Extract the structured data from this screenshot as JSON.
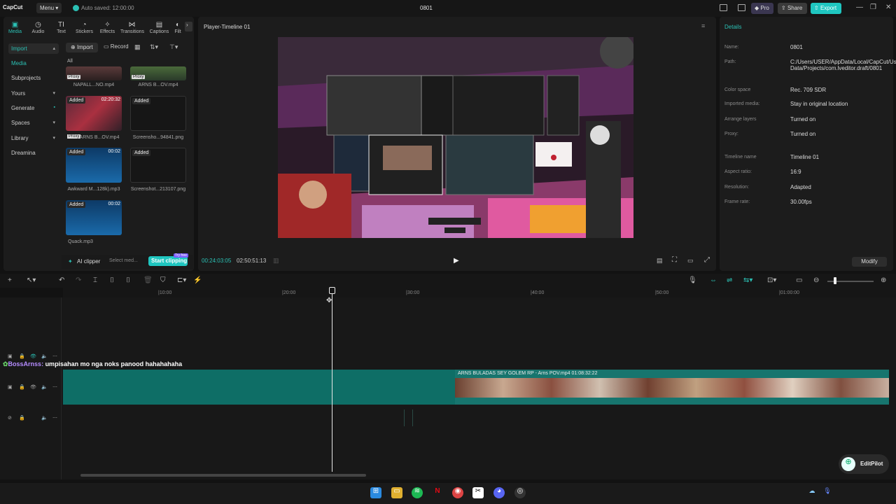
{
  "titlebar": {
    "logo": "CapCut",
    "menu": "Menu",
    "autosave": "Auto saved: 12:00:00",
    "project": "0801",
    "pro": "Pro",
    "share": "Share",
    "export": "Export"
  },
  "tabs": [
    "Media",
    "Audio",
    "Text",
    "Stickers",
    "Effects",
    "Transitions",
    "Captions",
    "Filt"
  ],
  "sidebar": {
    "import": "Import",
    "media": "Media",
    "subprojects": "Subprojects",
    "yours": "Yours",
    "generate": "Generate",
    "spaces": "Spaces",
    "library": "Library",
    "dreamina": "Dreamina"
  },
  "media_toolbar": {
    "import": "Import",
    "record": "Record",
    "filter_all": "All"
  },
  "media_items": [
    {
      "caption": "NAPALL...NO.mp4",
      "proxy": "Proxy"
    },
    {
      "caption": "ARNS B...OV.mp4",
      "proxy": "Proxy"
    },
    {
      "caption": "ARNS B...OV.mp4",
      "badge": "Added",
      "duration": "02:20:32",
      "proxy": "Proxy"
    },
    {
      "caption": "Screensho...94841.png",
      "badge": "Added"
    },
    {
      "caption": "Awkward M...128k).mp3",
      "badge": "Added",
      "duration": "00:02"
    },
    {
      "caption": "Screenshot...213107.png",
      "badge": "Added"
    },
    {
      "caption": "Quack.mp3",
      "badge": "Added",
      "duration": "00:02"
    }
  ],
  "aiclipper": {
    "label": "AI clipper",
    "select": "Select med...",
    "start": "Start clipping",
    "try": "Try free"
  },
  "player": {
    "title": "Player-Timeline 01",
    "current": "00:24:03:05",
    "total": "02:50:51:13"
  },
  "details": {
    "title": "Details",
    "rows": [
      {
        "k": "Name:",
        "v": "0801"
      },
      {
        "k": "Path:",
        "v": "C:/Users/USER/AppData/Local/CapCut/User Data/Projects/com.lveditor.draft/0801"
      },
      {
        "k": "Color space",
        "v": "Rec. 709 SDR"
      },
      {
        "k": "Imported media:",
        "v": "Stay in original location"
      },
      {
        "k": "Arrange layers",
        "v": "Turned on"
      },
      {
        "k": "Proxy:",
        "v": "Turned on"
      },
      {
        "k": "Timeline name",
        "v": "Timeline 01"
      },
      {
        "k": "Aspect ratio:",
        "v": "16:9"
      },
      {
        "k": "Resolution:",
        "v": "Adapted"
      },
      {
        "k": "Frame rate:",
        "v": "30.00fps"
      }
    ],
    "modify": "Modify"
  },
  "timeline": {
    "ticks": [
      "|10:00",
      "|20:00",
      "|30:00",
      "|40:00",
      "|50:00",
      "|01:00:00"
    ],
    "clip_label": "ARNS BULADAS SEY GOLEM RP - Arns POV.mp4   01:08:32:22",
    "chat_name": "BossArnss:",
    "chat_msg": " umpisahan mo nga noks panood hahahahaha"
  },
  "editpilot": "EditPilot"
}
